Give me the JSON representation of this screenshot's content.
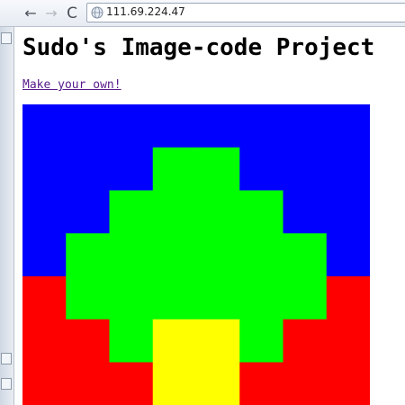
{
  "browser": {
    "back_label": "←",
    "forward_label": "→",
    "reload_label": "C",
    "url": "111.69.224.47"
  },
  "page": {
    "title": "Sudo's Image-code Project",
    "link_text": "Make your own!"
  },
  "artwork": {
    "grid_columns": 8,
    "grid_rows": 7,
    "colors": {
      "sky": "#0000ff",
      "ground": "#ff0000",
      "foliage": "#00ff00",
      "trunk": "#ffff00"
    },
    "rows": [
      "BBBBBBBB",
      "BBBGGBBB",
      "BBGGGGBB",
      "BGGGGGGB",
      "RGGGGGGR",
      "RRGYYGRR",
      "RRRYYRRR"
    ]
  }
}
